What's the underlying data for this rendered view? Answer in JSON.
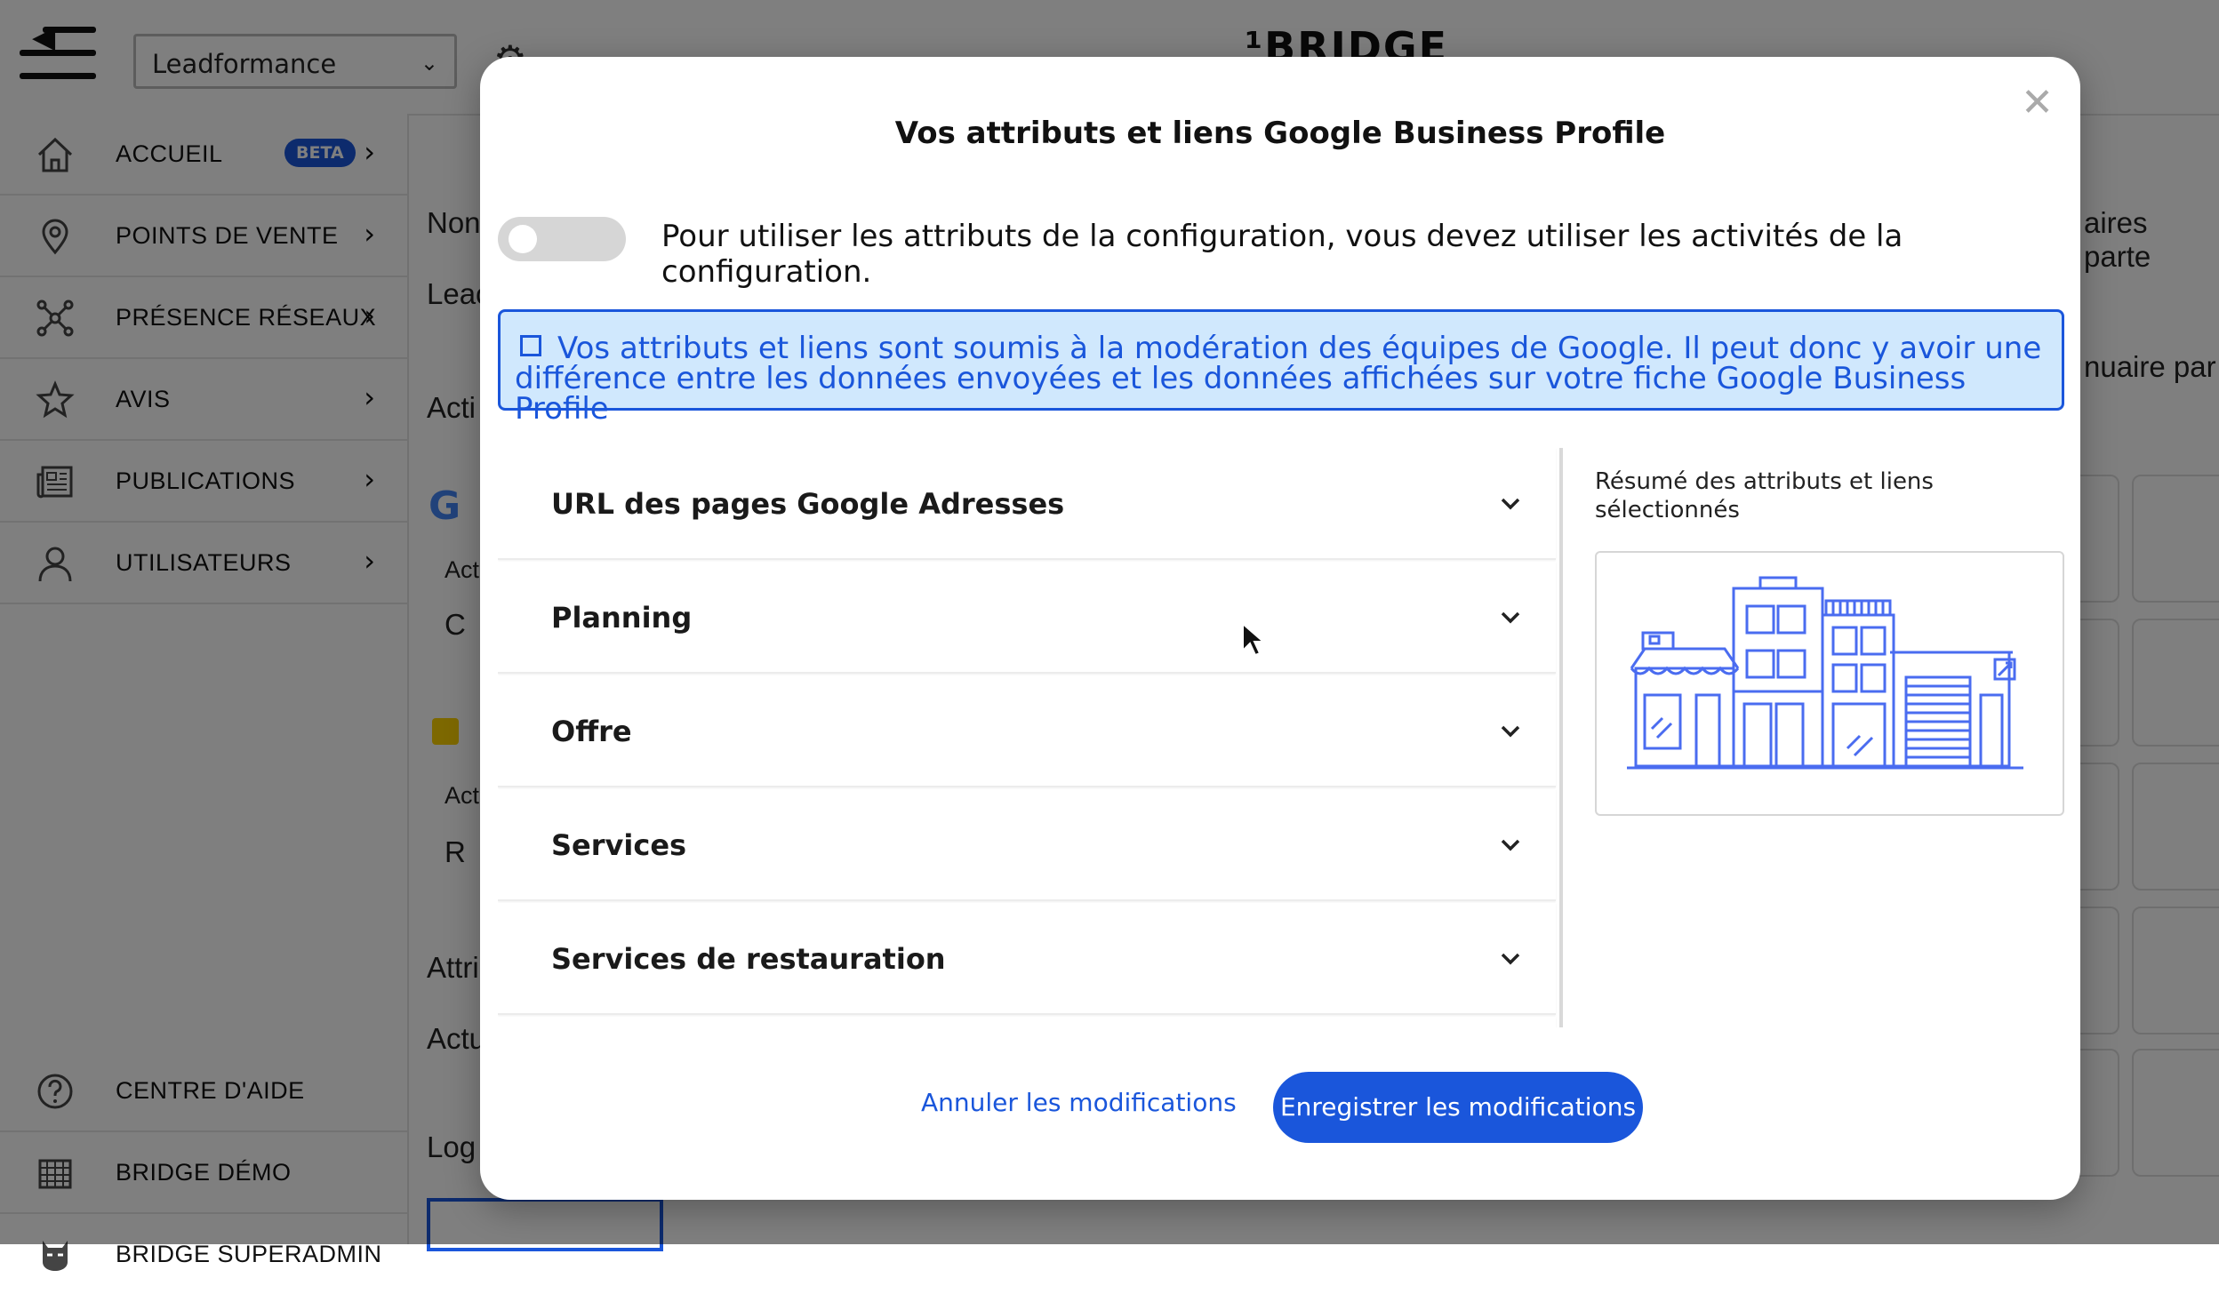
{
  "header": {
    "org_select_value": "Leadformance",
    "brand_logo_text": "¹BRIDGE"
  },
  "sidebar": {
    "items": [
      {
        "label": "ACCUEIL",
        "badge": "BETA"
      },
      {
        "label": "POINTS DE VENTE"
      },
      {
        "label": "PRÉSENCE RÉSEAUX"
      },
      {
        "label": "AVIS"
      },
      {
        "label": "PUBLICATIONS"
      },
      {
        "label": "UTILISATEURS"
      }
    ],
    "bottom_items": [
      {
        "label": "CENTRE D'AIDE"
      },
      {
        "label": "BRIDGE DÉMO"
      },
      {
        "label": "BRIDGE SUPERADMIN"
      }
    ]
  },
  "background": {
    "fragments": [
      "Non",
      "Leac",
      "Acti",
      "Act",
      "C",
      "Act",
      "R",
      "Attri",
      "Actu",
      "Log",
      "aires parte",
      "nuaire par"
    ]
  },
  "modal": {
    "title": "Vos attributs et liens Google Business Profile",
    "toggle_label": "Pour utiliser les attributs de la configuration, vous devez utiliser les activités de la configuration.",
    "info_text": "Vos attributs et liens sont soumis à la modération des équipes de Google. Il peut donc y avoir une différence entre les données envoyées et les données affichées sur votre fiche Google Business Profile",
    "sections": [
      {
        "label": "URL des pages Google Adresses"
      },
      {
        "label": "Planning"
      },
      {
        "label": "Offre"
      },
      {
        "label": "Services"
      },
      {
        "label": "Services de restauration"
      }
    ],
    "summary_title": "Résumé des attributs et liens sélectionnés",
    "cancel_label": "Annuler les modifications",
    "save_label": "Enregistrer les modifications"
  },
  "colors": {
    "accent": "#1a56db",
    "info_bg": "#d0e8fd",
    "overlay": "rgba(0,0,0,0.5)"
  }
}
